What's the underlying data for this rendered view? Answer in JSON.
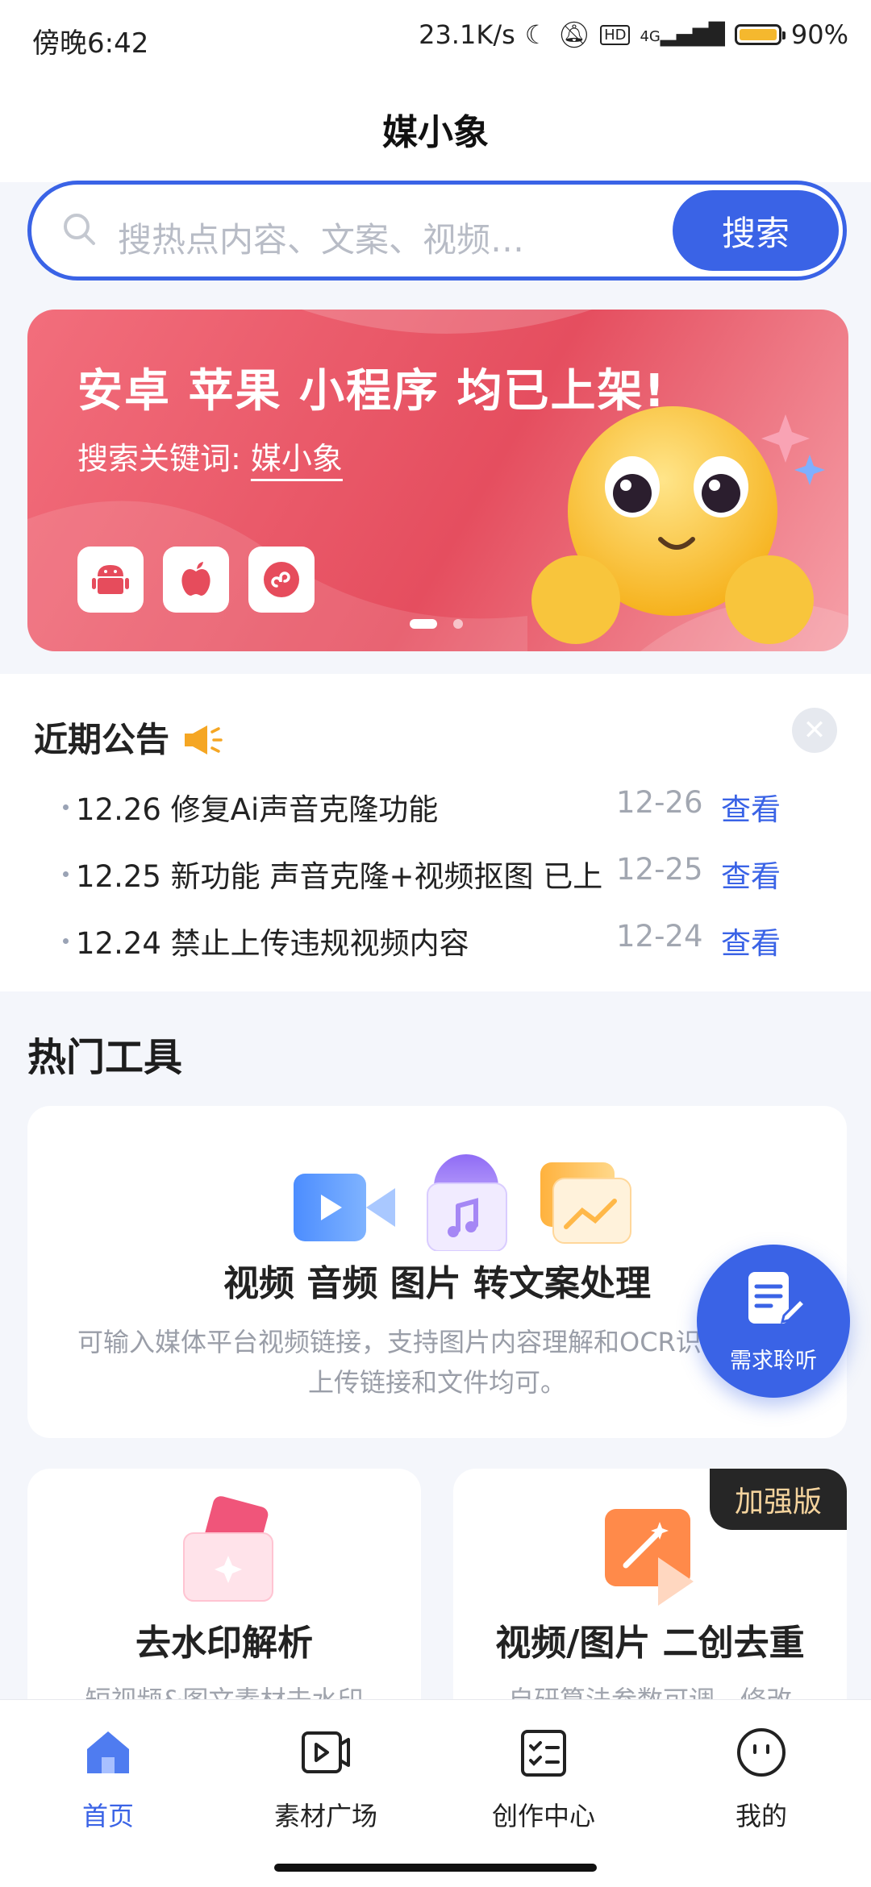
{
  "status_bar": {
    "time": "傍晚6:42",
    "speed": "23.1K/s",
    "network": "4G",
    "battery": "90%"
  },
  "header": {
    "title": "媒小象"
  },
  "search": {
    "placeholder": "搜热点内容、文案、视频…",
    "button_label": "搜索"
  },
  "banner": {
    "title": "安卓 苹果 小程序 均已上架!",
    "subtitle_prefix": "搜索关键词:",
    "keyword": "媒小象",
    "platform_icons": [
      "android-icon",
      "apple-icon",
      "mini-program-icon"
    ],
    "page_count": 2,
    "current_page": 1
  },
  "notice": {
    "title": "近期公告",
    "items": [
      {
        "text": "12.26 修复Ai声音克隆功能",
        "date": "12-26",
        "action": "查看"
      },
      {
        "text": "12.25 新功能 声音克隆+视频抠图 已上",
        "date": "12-25",
        "action": "查看"
      },
      {
        "text": "12.24 禁止上传违规视频内容",
        "date": "12-24",
        "action": "查看"
      }
    ]
  },
  "hot_tools": {
    "title": "热门工具",
    "main_card": {
      "title": "视频 音频 图片 转文案处理",
      "desc_line1": "可输入媒体平台视频链接，支持图片内容理解和OCR识",
      "desc_line2": "上传链接和文件均可。"
    },
    "cards": [
      {
        "title": "去水印解析",
        "desc": "短视频&图文素材去水印"
      },
      {
        "title": "视频/图片 二创去重",
        "desc": "自研算法参数可调，修改",
        "badge": "加强版"
      }
    ]
  },
  "fab": {
    "label": "需求聆听"
  },
  "bottom_nav": [
    {
      "label": "首页",
      "active": true
    },
    {
      "label": "素材广场",
      "active": false
    },
    {
      "label": "创作中心",
      "active": false
    },
    {
      "label": "我的",
      "active": false
    }
  ],
  "colors": {
    "primary": "#3a63e6",
    "banner": "#e54e5f",
    "badge_bg": "#262626",
    "badge_text": "#f4d39d"
  }
}
